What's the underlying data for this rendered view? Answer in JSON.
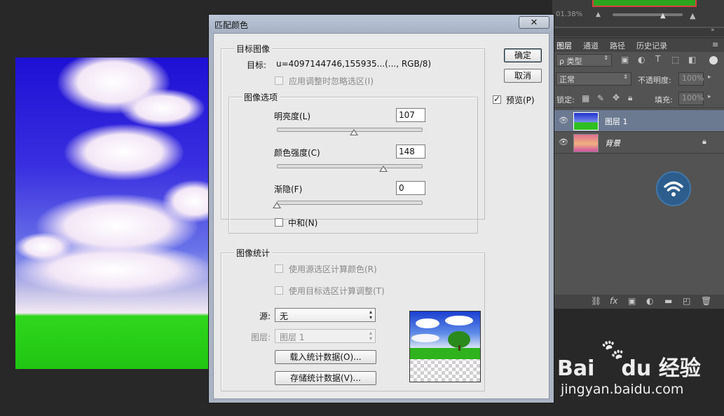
{
  "right_panel": {
    "zoom_text": "01.38%",
    "tabs": [
      "图层",
      "通道",
      "路径",
      "历史记录"
    ],
    "filter_label": "类型",
    "blend_mode": "正常",
    "opacity_label": "不透明度:",
    "opacity_value": "100%",
    "lock_label": "锁定:",
    "fill_label": "填充:",
    "fill_value": "100%",
    "layers": [
      {
        "name": "图层 1"
      },
      {
        "name": "背景"
      }
    ],
    "bottom_icons": [
      "link-icon",
      "fx-icon",
      "mask-icon",
      "adjustment-icon",
      "folder-icon",
      "new-layer-icon",
      "trash-icon"
    ]
  },
  "dialog": {
    "title": "匹配颜色",
    "close_glyph": "✕",
    "target_group": {
      "legend": "目标图像",
      "target_label": "目标:",
      "target_value": "u=4097144746,155935...(..., RGB/8)",
      "ignore_selection_label": "应用调整时忽略选区(I)"
    },
    "image_options": {
      "legend": "图像选项",
      "luminance_label": "明亮度(L)",
      "luminance_value": "107",
      "luminance": 107,
      "color_intensity_label": "颜色强度(C)",
      "color_intensity_value": "148",
      "color_intensity": 148,
      "fade_label": "渐隐(F)",
      "fade_value": "0",
      "fade": 0,
      "neutralize_label": "中和(N)"
    },
    "image_stats": {
      "legend": "图像统计",
      "use_source_selection_label": "使用源选区计算颜色(R)",
      "use_target_selection_label": "使用目标选区计算调整(T)",
      "source_label": "源:",
      "source_value": "无",
      "layer_label": "图层:",
      "layer_value": "图层 1",
      "load_stats_label": "载入统计数据(O)...",
      "save_stats_label": "存储统计数据(V)..."
    },
    "ok_label": "确定",
    "cancel_label": "取消",
    "preview_label": "预览(P)"
  },
  "watermark": {
    "brand_left": "Bai",
    "brand_right": "du",
    "brand_cn": "经验",
    "url": "jingyan.baidu.com"
  }
}
